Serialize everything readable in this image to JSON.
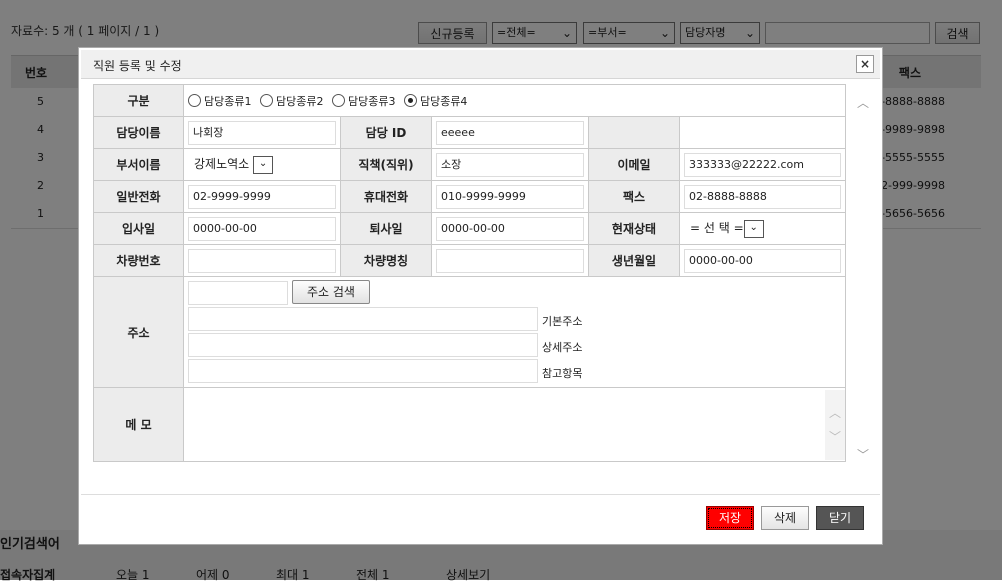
{
  "background": {
    "count_text": "자료수: 5 개 ( 1 페이지 / 1 )",
    "new_button": "신규등록",
    "filter_all": "=전체=",
    "filter_dept": "=부서=",
    "filter_name": "담당자명",
    "search_button": "검색",
    "header_number": "번호",
    "header_fax": "팩스",
    "rows": [
      {
        "num": "5",
        "fax": "-8888-8888"
      },
      {
        "num": "4",
        "fax": "-9989-9898"
      },
      {
        "num": "3",
        "fax": "-5555-5555"
      },
      {
        "num": "2",
        "fax": "2-999-9998"
      },
      {
        "num": "1",
        "fax": "-5656-5656"
      }
    ],
    "popular_search": "인기검색어",
    "visitor_stats": "접속자집계",
    "stats": [
      "오늘 1",
      "어제 0",
      "최대 1",
      "전체 1",
      "상세보기"
    ]
  },
  "modal": {
    "title": "직원 등록 및 수정",
    "close_icon": "×",
    "labels": {
      "type": "구분",
      "name": "담당이름",
      "id": "담당 ID",
      "dept": "부서이름",
      "position": "직책(직위)",
      "email": "이메일",
      "phone": "일반전화",
      "mobile": "휴대전화",
      "fax": "팩스",
      "join": "입사일",
      "leave": "퇴사일",
      "status": "현재상태",
      "car_no": "차량번호",
      "car_name": "차량명칭",
      "birth": "생년월일",
      "address": "주소",
      "memo": "메 모"
    },
    "radios": [
      {
        "label": "담당종류1",
        "checked": false
      },
      {
        "label": "담당종류2",
        "checked": false
      },
      {
        "label": "담당종류3",
        "checked": false
      },
      {
        "label": "담당종류4",
        "checked": true
      }
    ],
    "values": {
      "name": "나회장",
      "id": "eeeee",
      "dept": "강제노역소",
      "position": "소장",
      "email": "333333@22222.com",
      "phone": "02-9999-9999",
      "mobile": "010-9999-9999",
      "fax": "02-8888-8888",
      "join": "0000-00-00",
      "leave": "0000-00-00",
      "status": "= 선 택 =",
      "car_no": "",
      "car_name": "",
      "birth": "0000-00-00"
    },
    "address": {
      "search_button": "주소 검색",
      "basic": "기본주소",
      "detail": "상세주소",
      "reference": "참고항목"
    },
    "buttons": {
      "save": "저장",
      "delete": "삭제",
      "close": "닫기"
    }
  }
}
